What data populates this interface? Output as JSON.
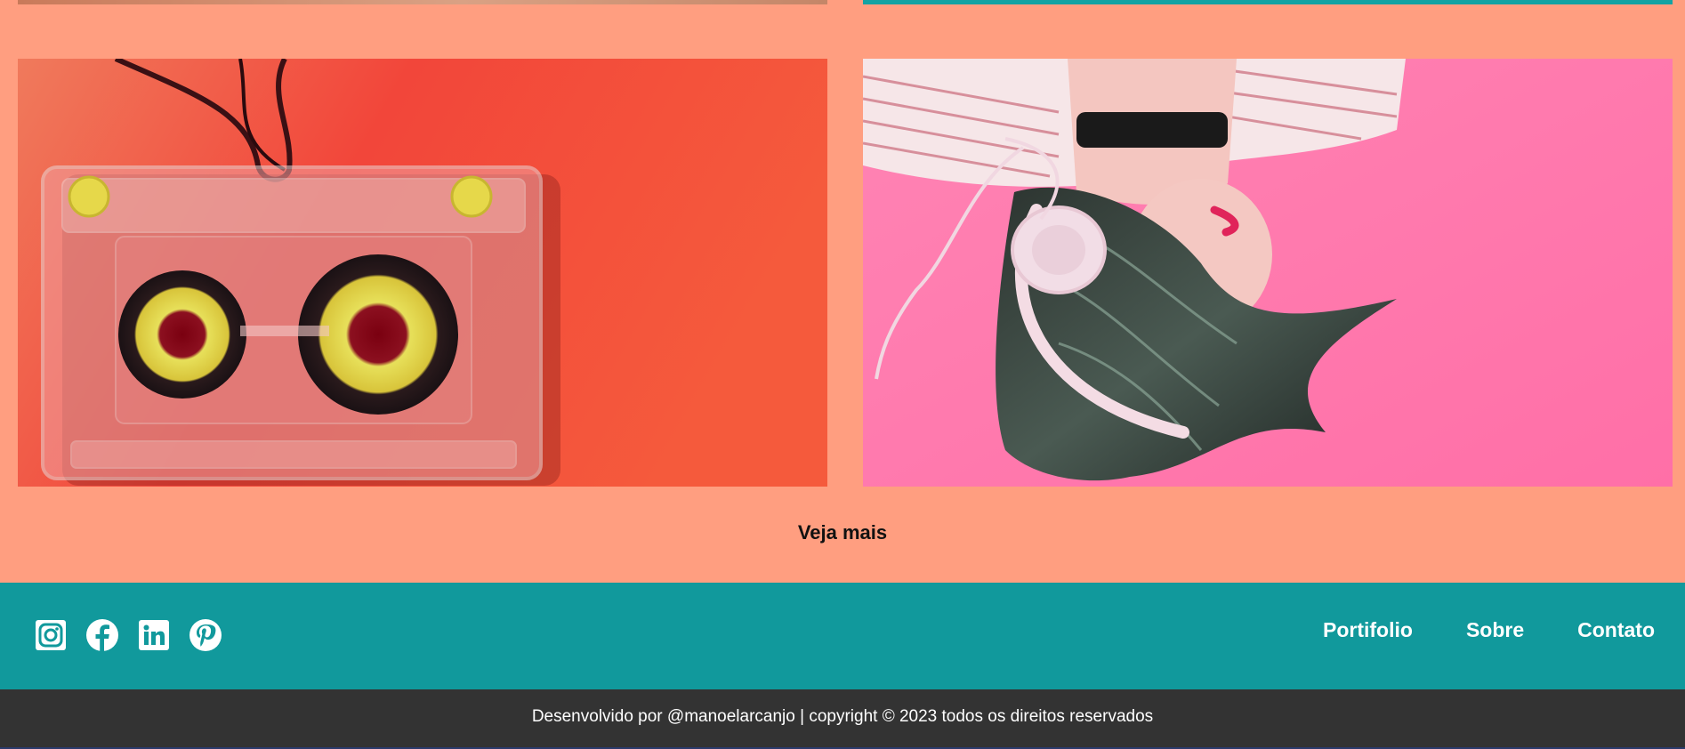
{
  "gallery": {
    "images": [
      {
        "subject": "cassette-tape-on-red-background"
      },
      {
        "subject": "woman-with-headphones-on-pink-background"
      }
    ]
  },
  "see_more_label": "Veja mais",
  "footer": {
    "social": [
      "instagram-icon",
      "facebook-icon",
      "linkedin-icon",
      "pinterest-icon"
    ],
    "nav": {
      "portfolio": "Portifolio",
      "about": "Sobre",
      "contact": "Contato"
    },
    "copyright": "Desenvolvido por @manoelarcanjo | copyright © 2023 todos os direitos reservados"
  },
  "colors": {
    "page_bg": "#ff9e80",
    "footer_bg": "#11999c",
    "copyright_bg": "#333333",
    "text_light": "#ffffff"
  }
}
